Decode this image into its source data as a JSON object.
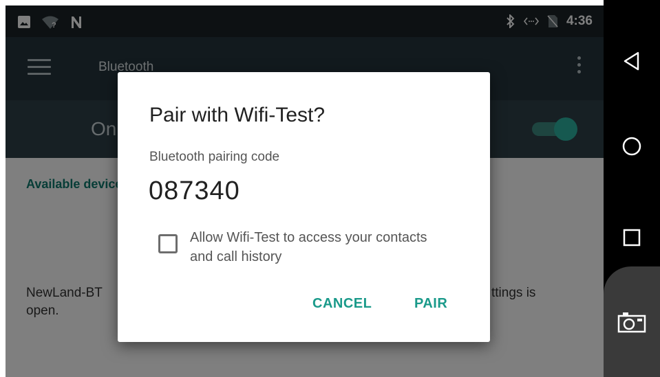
{
  "status_bar": {
    "time": "4:36",
    "icons": [
      "image-icon",
      "wifi-unknown-icon",
      "nfc-n-icon",
      "bluetooth-icon",
      "data-sync-icon",
      "no-sim-icon"
    ]
  },
  "app_bar": {
    "title": "Bluetooth",
    "menu_icon": "hamburger-menu-icon",
    "overflow_icon": "more-vert-icon"
  },
  "master_switch": {
    "label": "On",
    "state": true,
    "accent": "#2db3a0"
  },
  "content": {
    "section_header": "Available devices",
    "device_line1_left": "NewLand-BT",
    "device_line1_right": "ttings is",
    "device_line2": "open."
  },
  "dialog": {
    "title": "Pair with Wifi-Test?",
    "subtitle": "Bluetooth pairing code",
    "code": "087340",
    "checkbox_label": "Allow Wifi-Test to access your contacts and call history",
    "checkbox_checked": false,
    "cancel_label": "CANCEL",
    "pair_label": "PAIR",
    "accent": "#1a9a8a"
  },
  "nav_bar": {
    "buttons": [
      "back-icon",
      "home-icon",
      "recents-icon",
      "camera-icon"
    ]
  }
}
